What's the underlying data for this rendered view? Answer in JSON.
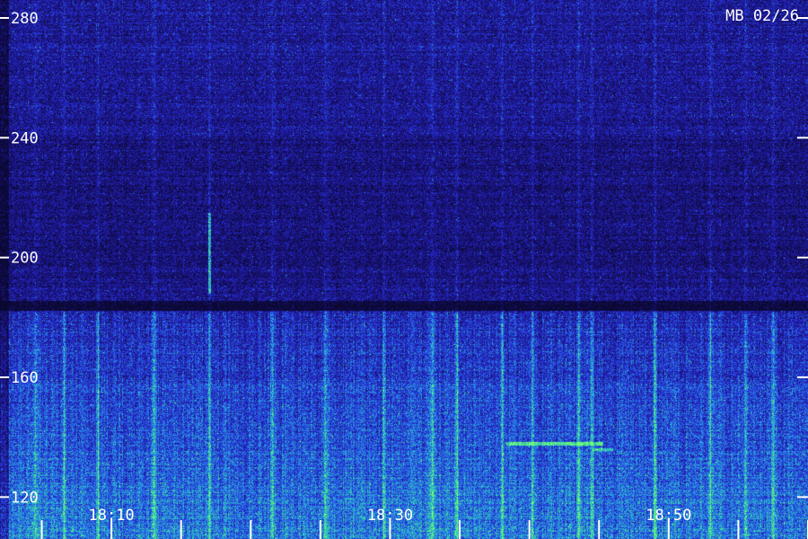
{
  "chart_data": {
    "type": "heatmap",
    "annotation": "MB 02/26",
    "y_ticks": [
      280,
      240,
      200,
      160,
      120
    ],
    "ylim": [
      106,
      286
    ],
    "x_tick_labels": [
      "18:10",
      "18:30",
      "18:50"
    ],
    "x_label_positions_min": [
      10,
      30,
      50
    ],
    "xlim_min": [
      2,
      60
    ],
    "x_minor_ticks_min": [
      0,
      5,
      10,
      15,
      20,
      25,
      30,
      35,
      40,
      45,
      50,
      55,
      60
    ],
    "colors": {
      "background": "#1a1a8c",
      "low": "#0e0a45",
      "mid": "#2a3dd8",
      "high": "#2ab3d8",
      "peak": "#3fe07a",
      "text": "#ffffff"
    },
    "features": {
      "dark_time_band_min": [
        0.9,
        2.6
      ],
      "dark_band_value": 184,
      "strong_band_range": [
        108,
        182
      ],
      "weak_upper_range": [
        182,
        286
      ],
      "bright_verticals_min": [
        4.5,
        6.6,
        9.0,
        13.0,
        17.0,
        21.5,
        25.3,
        29.5,
        33.0,
        34.8,
        38.0,
        40.2,
        43.5,
        44.5,
        49.0,
        53.0,
        55.5,
        57.5
      ],
      "short_spike_min": 17.0,
      "short_spike_range": [
        188,
        215
      ],
      "horizontal_trace_value": 138,
      "horizontal_trace_min": [
        38.3,
        45.3
      ],
      "horizontal_trace_value_2": 136,
      "horizontal_trace_min_2": [
        44.5,
        46.0
      ]
    }
  }
}
